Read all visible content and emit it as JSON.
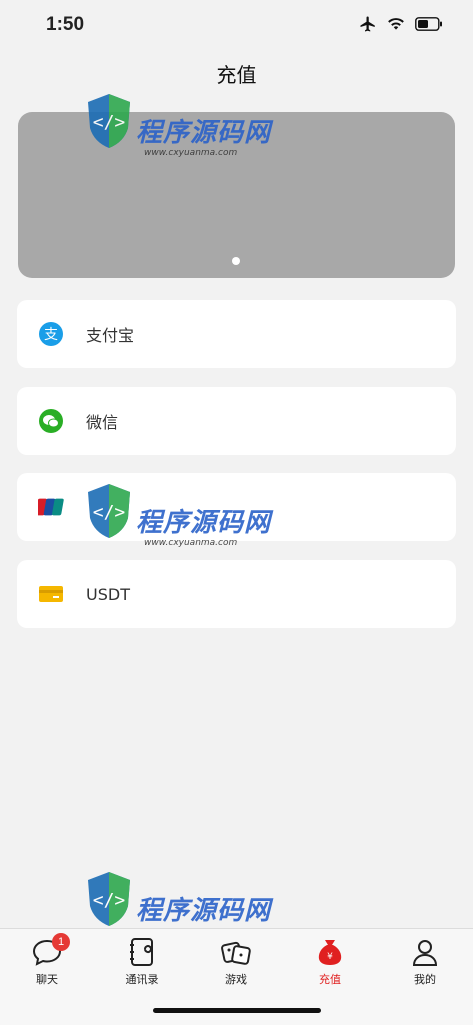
{
  "status": {
    "time": "1:50"
  },
  "nav": {
    "title": "充值"
  },
  "payment_methods": [
    {
      "label": "支付宝",
      "icon": "alipay-icon",
      "color": "#1a9ee8"
    },
    {
      "label": "微信",
      "icon": "wechat-icon",
      "color": "#2aae25"
    },
    {
      "label": "",
      "icon": "unionpay-icon",
      "color": "#d71c27"
    },
    {
      "label": "USDT",
      "icon": "card-icon",
      "color": "#f5b700"
    }
  ],
  "tabs": [
    {
      "label": "聊天",
      "icon": "chat-bubble-icon",
      "badge": "1"
    },
    {
      "label": "通讯录",
      "icon": "contacts-book-icon"
    },
    {
      "label": "游戏",
      "icon": "dice-icon"
    },
    {
      "label": "充值",
      "icon": "money-bag-icon",
      "active": true
    },
    {
      "label": "我的",
      "icon": "user-icon"
    }
  ],
  "watermark": {
    "text": "程序源码网",
    "url": "www.cxyuanma.com"
  },
  "colors": {
    "accent": "#e02020",
    "banner": "#a8a8a8"
  }
}
